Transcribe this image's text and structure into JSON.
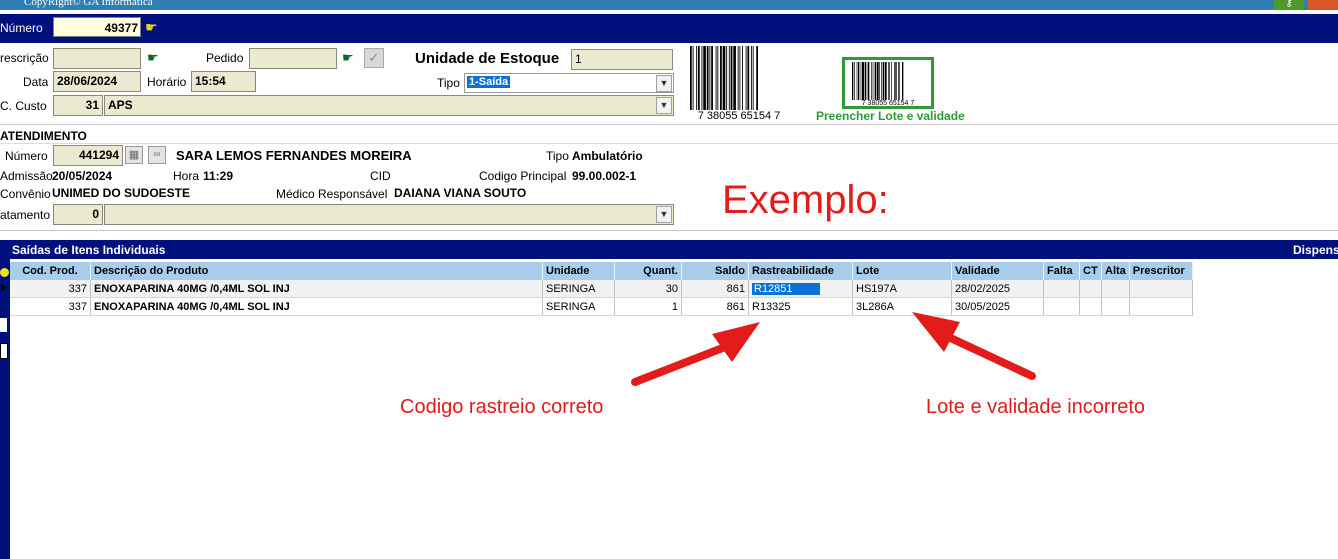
{
  "window": {
    "title": "CopyRight© GA Informática"
  },
  "header": {
    "numero_label": "Número",
    "numero_value": "49377"
  },
  "form": {
    "prescricao_label": "rescrição",
    "pedido_label": "Pedido",
    "unidade_label": "Unidade de Estoque",
    "unidade_value": "1",
    "data_label": "Data",
    "data_value": "28/06/2024",
    "horario_label": "Horário",
    "horario_value": "15:54",
    "tipo_label": "Tipo",
    "tipo_value": "1-Saída",
    "custo_label": "C. Custo",
    "custo_code": "31",
    "custo_name": "APS",
    "barcode_number": "7 38055 65154 7",
    "barcode_note": "Preencher Lote e validade"
  },
  "atendimento": {
    "section_label": "ATENDIMENTO",
    "numero_label": "Número",
    "numero_value": "441294",
    "patient_name": "SARA LEMOS FERNANDES MOREIRA",
    "tipo_label": "Tipo",
    "tipo_value": "Ambulatório",
    "admissao_label": "Admissão",
    "admissao_value": "20/05/2024",
    "hora_label": "Hora",
    "hora_value": "11:29",
    "cid_label": "CID",
    "codigo_label": "Codigo Principal",
    "codigo_value": "99.00.002-1",
    "convenio_label": "Convênio",
    "convenio_value": "UNIMED DO SUDOESTE",
    "medico_label": "Médico Responsável",
    "medico_value": "DAIANA VIANA SOUTO",
    "tratamento_label": "atamento",
    "tratamento_value": "0"
  },
  "annotations": {
    "exemplo": "Exemplo:",
    "left": "Codigo rastreio correto",
    "right": "Lote e validade incorreto"
  },
  "grid": {
    "title": "Saídas de Itens Individuais",
    "title_right": "Dispens",
    "columns": [
      "Cod. Prod.",
      "Descrição do Produto",
      "Unidade",
      "Quant.",
      "Saldo",
      "Rastreabilidade",
      "Lote",
      "Validade",
      "Falta",
      "CT",
      "Alta",
      "Prescritor"
    ],
    "rows": [
      {
        "cod": "337",
        "desc": "ENOXAPARINA 40MG /0,4ML SOL INJ",
        "unidade": "SERINGA",
        "quant": "30",
        "saldo": "861",
        "rastreabilidade": "R12851",
        "lote": "HS197A",
        "validade": "28/02/2025"
      },
      {
        "cod": "337",
        "desc": "ENOXAPARINA 40MG /0,4ML SOL INJ",
        "unidade": "SERINGA",
        "quant": "1",
        "saldo": "861",
        "rastreabilidade": "R13325",
        "lote": "3L286A",
        "validade": "30/05/2025"
      }
    ]
  },
  "colors": {
    "navy": "#00107c",
    "grid_header": "#a8cdec",
    "annotation_red": "#e21b1b",
    "barcode_green": "#2e9a3a"
  }
}
